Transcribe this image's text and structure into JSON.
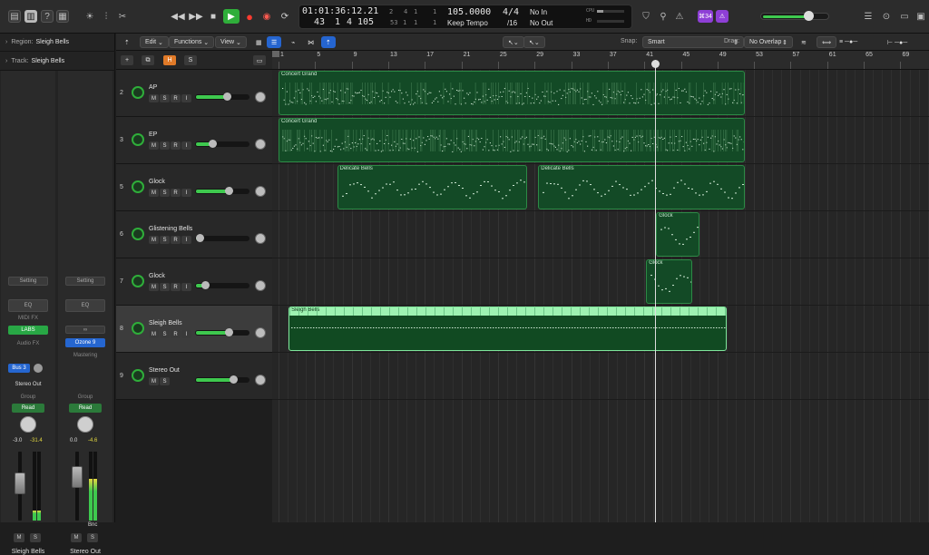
{
  "lcd": {
    "time": "01:01:36:12.21",
    "bar_top": "2",
    "beat_top": "4",
    "div_top": "1",
    "tick_top": "1",
    "bar": "43",
    "beat": "1",
    "division": "4",
    "tick": "105",
    "bar_bottom": "53",
    "beat_bottom": "1",
    "div_bottom": "1",
    "tick_bottom": "1",
    "tempo": "105.0000",
    "tempo_mode": "Keep Tempo",
    "signature": "4/4",
    "division_value": "/16",
    "midi_in": "No In",
    "midi_out": "No Out",
    "cpu_label": "CPU",
    "hd_label": "HD"
  },
  "topbar": {
    "plugin_badge": "⌘34",
    "colors": {
      "play": "#2fae3a",
      "record": "#ff3b30",
      "badge": "#8e3fd6"
    },
    "master_volume": 0.72
  },
  "inspector": {
    "region_label": "Region:",
    "region_name": "Sleigh Bells",
    "track_label": "Track:",
    "track_name": "Sleigh Bells",
    "strips": [
      {
        "setting": "Setting",
        "eq": "EQ",
        "midi_fx": "MIDI FX",
        "instrument": "LABS",
        "audio_fx": "Audio FX",
        "send": "Bus 3",
        "output": "Stereo Out",
        "group": "Group",
        "automation": "Read",
        "volume": "-3.0",
        "peak": "-31.4",
        "mute": "M",
        "solo": "S",
        "name": "Sleigh Bells",
        "meter_level": 0.15
      },
      {
        "setting": "Setting",
        "eq": "EQ",
        "link": "∞",
        "insert": "Ozone 9",
        "mastering": "Mastering",
        "group": "Group",
        "automation": "Read",
        "volume": "0.0",
        "peak": "-4.6",
        "mute": "M",
        "solo": "S",
        "bounce": "Bnc",
        "name": "Stereo Out",
        "meter_level": 0.6
      }
    ]
  },
  "track_toolbar": {
    "edit": "Edit",
    "functions": "Functions",
    "view": "View",
    "snap_label": "Snap:",
    "snap_value": "Smart",
    "drag_label": "Drag:",
    "drag_value": "No Overlap"
  },
  "header_bar": {
    "add": "+",
    "h": "H",
    "s": "S"
  },
  "tracks": [
    {
      "number": "2",
      "name": "AP",
      "m": "M",
      "s": "S",
      "r": "R",
      "i": "I",
      "volume": 0.6
    },
    {
      "number": "3",
      "name": "EP",
      "m": "M",
      "s": "S",
      "r": "R",
      "i": "I",
      "volume": 0.33
    },
    {
      "number": "5",
      "name": "Glock",
      "m": "M",
      "s": "S",
      "r": "R",
      "i": "I",
      "volume": 0.63
    },
    {
      "number": "6",
      "name": "Glistening Bells",
      "m": "M",
      "s": "S",
      "r": "R",
      "i": "I",
      "volume": 0.1
    },
    {
      "number": "7",
      "name": "Glock",
      "m": "M",
      "s": "S",
      "r": "R",
      "i": "I",
      "volume": 0.2
    },
    {
      "number": "8",
      "name": "Sleigh Bells",
      "m": "M",
      "s": "S",
      "r": "R",
      "i": "I",
      "volume": 0.63
    },
    {
      "number": "9",
      "name": "Stereo Out",
      "m": "M",
      "s": "S",
      "volume": 0.72
    }
  ],
  "ruler": {
    "labels": [
      "1",
      "5",
      "9",
      "13",
      "17",
      "21",
      "25",
      "29",
      "33",
      "37",
      "41",
      "45",
      "49",
      "53",
      "57",
      "61",
      "65",
      "69"
    ]
  },
  "regions": [
    {
      "name": "Concert Grand",
      "lane": 0,
      "start": 1,
      "end": 52,
      "selected": false,
      "density": "dense"
    },
    {
      "name": "Concert Grand",
      "lane": 1,
      "start": 1,
      "end": 52,
      "selected": false,
      "density": "dense"
    },
    {
      "name": "Delicate Bells",
      "lane": 2,
      "start": 7.4,
      "end": 28.2,
      "selected": false,
      "density": "sparse"
    },
    {
      "name": "Delicate Bells",
      "lane": 2,
      "start": 29.4,
      "end": 52,
      "selected": false,
      "density": "sparse"
    },
    {
      "name": "Glock",
      "lane": 3,
      "start": 42.3,
      "end": 47,
      "selected": false,
      "density": "sparse"
    },
    {
      "name": "Glock",
      "lane": 4,
      "start": 41.2,
      "end": 46.2,
      "selected": false,
      "density": "sparse"
    },
    {
      "name": "Sleigh Bells",
      "lane": 5,
      "start": 2.1,
      "end": 50,
      "selected": true,
      "density": "line"
    }
  ],
  "playhead_bar": 42.2
}
